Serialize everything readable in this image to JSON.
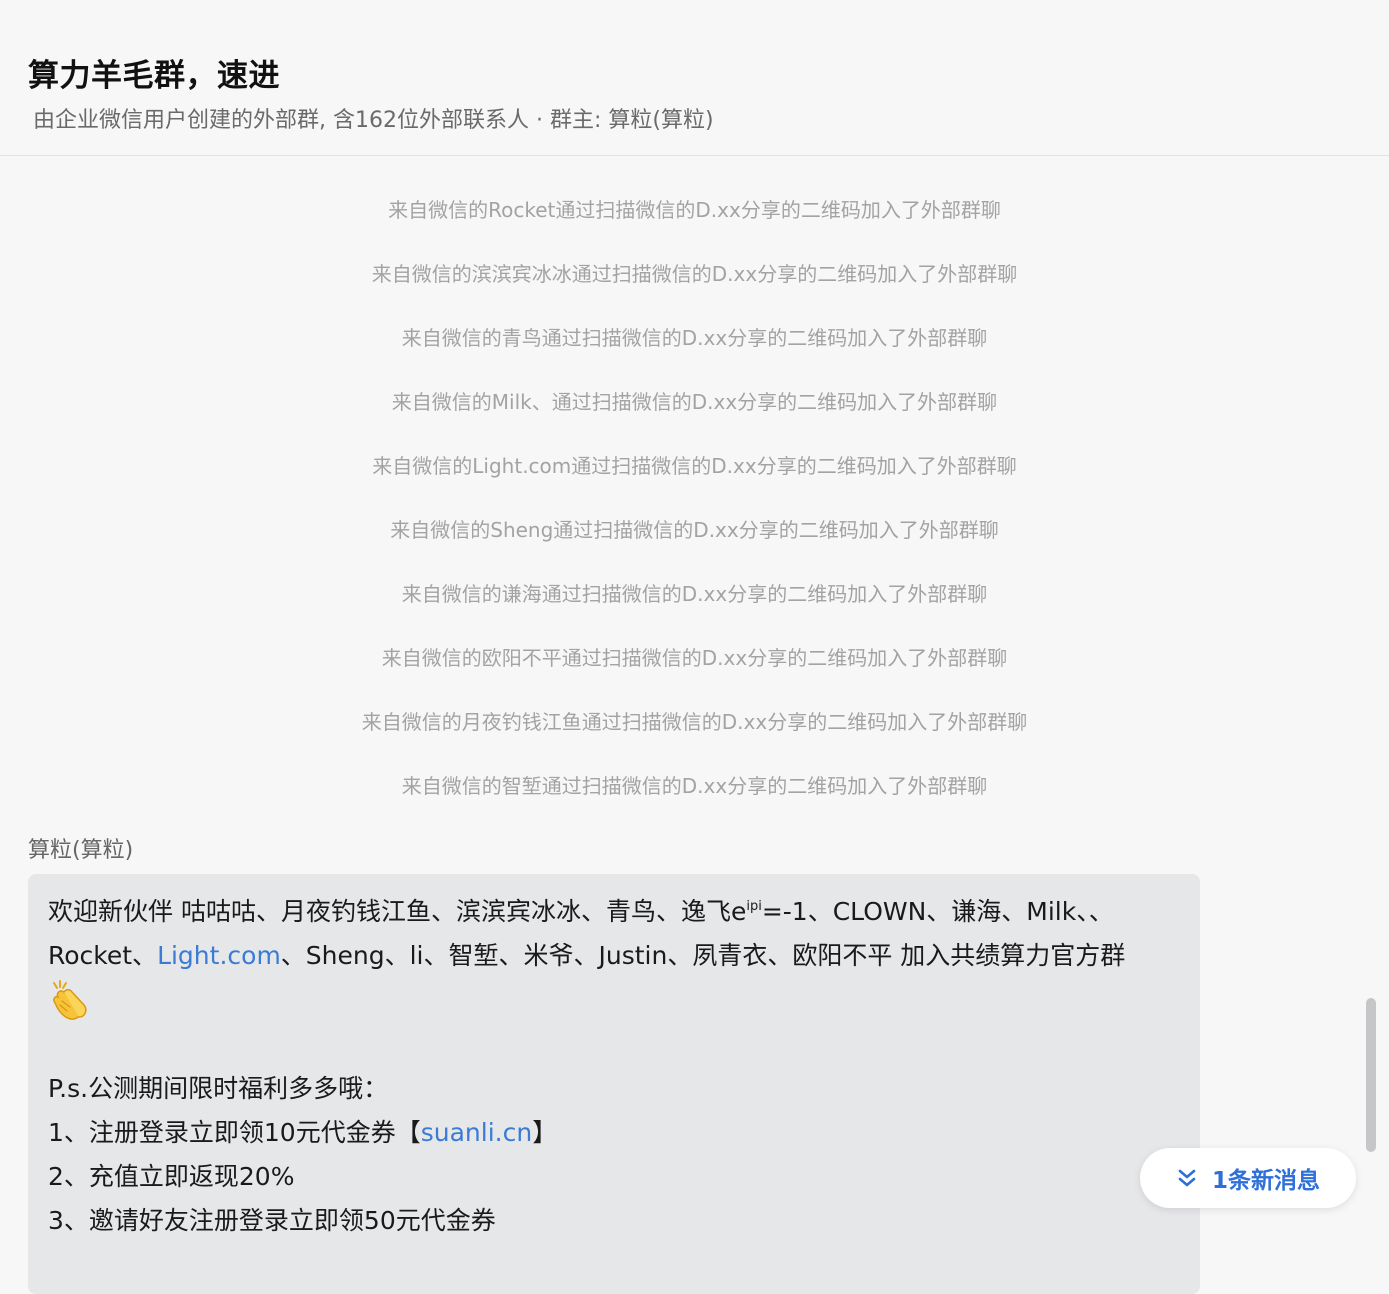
{
  "header": {
    "title": "算力羊毛群，速进",
    "subtitle": "由企业微信用户创建的外部群, 含162位外部联系人 · 群主: 算粒(算粒)"
  },
  "system_messages": [
    "来自微信的Rocket通过扫描微信的D.xx分享的二维码加入了外部群聊",
    "来自微信的滨滨宾冰冰通过扫描微信的D.xx分享的二维码加入了外部群聊",
    "来自微信的青鸟通过扫描微信的D.xx分享的二维码加入了外部群聊",
    "来自微信的Milk、通过扫描微信的D.xx分享的二维码加入了外部群聊",
    "来自微信的Light.com通过扫描微信的D.xx分享的二维码加入了外部群聊",
    "来自微信的Sheng通过扫描微信的D.xx分享的二维码加入了外部群聊",
    "来自微信的谦海通过扫描微信的D.xx分享的二维码加入了外部群聊",
    "来自微信的欧阳不平通过扫描微信的D.xx分享的二维码加入了外部群聊",
    "来自微信的月夜钓钱江鱼通过扫描微信的D.xx分享的二维码加入了外部群聊",
    "来自微信的智堑通过扫描微信的D.xx分享的二维码加入了外部群聊"
  ],
  "message": {
    "sender": "算粒(算粒)",
    "line1_text": "欢迎新伙伴 咕咕咕、月夜钓钱江鱼、滨滨宾冰冰、青鸟、逸飞e",
    "line1_sup": "ipi",
    "line1_rest": "=-1、CLOWN、谦海、Milk、、",
    "line2_pre": "Rocket、",
    "line2_link": "Light.com",
    "line2_post": "、Sheng、li、智堑、米爷、Justin、夙青衣、欧阳不平 加入共绩算力官方群",
    "emoji": "clapping-hands-emoji",
    "ps": "P.s.公测期间限时福利多多哦：",
    "item1_pre": "1、注册登录立即领10元代金券【",
    "item1_link": "suanli.cn",
    "item1_post": "】",
    "item2": "2、充值立即返现20%",
    "item3": "3、邀请好友注册登录立即领50元代金券"
  },
  "new_message_button": {
    "label": "1条新消息",
    "icon": "double-chevron-down-icon"
  },
  "colors": {
    "link": "#3a7bd5",
    "accent": "#2e6fd9",
    "system_text": "#a3a3a3",
    "bubble_bg": "#e6e7e9"
  }
}
